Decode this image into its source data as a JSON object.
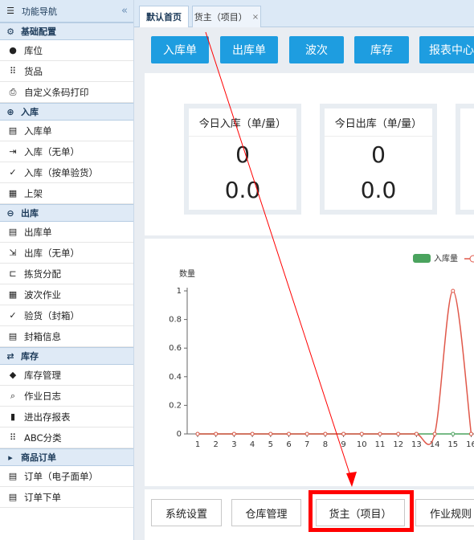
{
  "sidebar": {
    "title": "功能导航",
    "collapse_glyph": "«",
    "sections": [
      {
        "title": "基础配置",
        "icon": "gear-icon",
        "items": [
          {
            "label": "库位",
            "icon": "location-pin-icon"
          },
          {
            "label": "货品",
            "icon": "grid-dots-icon"
          },
          {
            "label": "自定义条码打印",
            "icon": "printer-icon"
          }
        ]
      },
      {
        "title": "入库",
        "icon": "inbound-circle-icon",
        "items": [
          {
            "label": "入库单",
            "icon": "document-icon"
          },
          {
            "label": "入库（无单）",
            "icon": "enter-icon"
          },
          {
            "label": "入库（按单验货）",
            "icon": "check-icon"
          },
          {
            "label": "上架",
            "icon": "film-icon"
          }
        ]
      },
      {
        "title": "出库",
        "icon": "outbound-circle-icon",
        "items": [
          {
            "label": "出库单",
            "icon": "document-icon"
          },
          {
            "label": "出库（无单）",
            "icon": "exit-icon"
          },
          {
            "label": "拣货分配",
            "icon": "cart-icon"
          },
          {
            "label": "波次作业",
            "icon": "table-icon"
          },
          {
            "label": "验货（封箱）",
            "icon": "check-icon"
          },
          {
            "label": "封箱信息",
            "icon": "list-box-icon"
          }
        ]
      },
      {
        "title": "库存",
        "icon": "swap-arrows-icon",
        "items": [
          {
            "label": "库存管理",
            "icon": "cube-icon"
          },
          {
            "label": "作业日志",
            "icon": "search-icon"
          },
          {
            "label": "进出存报表",
            "icon": "bar-chart-icon"
          },
          {
            "label": "ABC分类",
            "icon": "grid-dots-icon"
          }
        ]
      },
      {
        "title": "商品订单",
        "icon": "caret-right-icon",
        "items": [
          {
            "label": "订单（电子面单）",
            "icon": "document-icon"
          },
          {
            "label": "订单下单",
            "icon": "document-icon"
          }
        ]
      }
    ]
  },
  "tabs": [
    {
      "label": "默认首页",
      "active": true
    },
    {
      "label": "货主（项目）",
      "close": "×"
    }
  ],
  "quick_buttons": [
    "入库单",
    "出库单",
    "波次",
    "库存",
    "报表中心"
  ],
  "stats": [
    {
      "title": "今日入库（单/量）",
      "count": "0",
      "qty": "0.0"
    },
    {
      "title": "今日出库（单/量）",
      "count": "0",
      "qty": "0.0"
    }
  ],
  "chart_data": {
    "type": "line",
    "ylabel": "数量",
    "ylim": [
      0,
      1
    ],
    "yticks": [
      "0",
      "0.2",
      "0.4",
      "0.6",
      "0.8",
      "1"
    ],
    "x": [
      1,
      2,
      3,
      4,
      5,
      6,
      7,
      8,
      9,
      10,
      11,
      12,
      13,
      14,
      15,
      16
    ],
    "series": [
      {
        "name": "入库量",
        "color": "#4aa35e",
        "values": [
          0,
          0,
          0,
          0,
          0,
          0,
          0,
          0,
          0,
          0,
          0,
          0,
          0,
          0,
          0,
          0
        ]
      },
      {
        "name": "",
        "color": "#e0584a",
        "values": [
          0,
          0,
          0,
          0,
          0,
          0,
          0,
          0,
          0,
          0,
          0,
          0,
          0,
          0,
          1,
          0
        ]
      }
    ],
    "legend_position": "top-right"
  },
  "bottom_buttons": [
    "系统设置",
    "仓库管理",
    "货主（项目）",
    "作业规则"
  ],
  "colors": {
    "accent": "#1e9de0",
    "highlight": "#ff0000",
    "arrow": "#ff0000"
  }
}
